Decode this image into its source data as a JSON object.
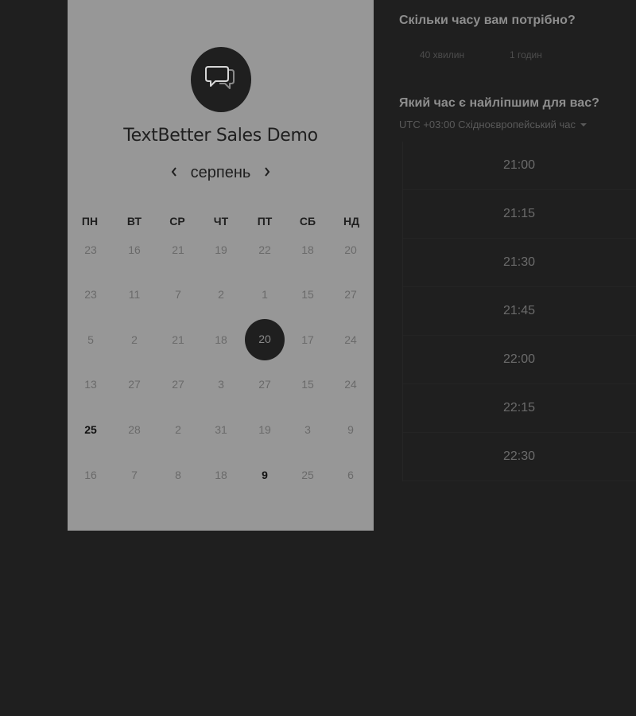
{
  "event": {
    "title": "TextBetter Sales Demo",
    "logo_icon": "chat-bubbles-icon"
  },
  "calendar": {
    "month": "серпень",
    "weekdays": [
      "ПН",
      "ВТ",
      "СР",
      "ЧТ",
      "ПТ",
      "СБ",
      "НД"
    ],
    "weeks": [
      [
        "23",
        "16",
        "21",
        "19",
        "22",
        "18",
        "20"
      ],
      [
        "23",
        "11",
        "7",
        "2",
        "1",
        "15",
        "27"
      ],
      [
        "5",
        "2",
        "21",
        "18",
        "20",
        "17",
        "24"
      ],
      [
        "13",
        "27",
        "27",
        "3",
        "27",
        "15",
        "24"
      ],
      [
        "25",
        "28",
        "2",
        "31",
        "19",
        "3",
        "9"
      ],
      [
        "16",
        "7",
        "8",
        "18",
        "9",
        "25",
        "6"
      ]
    ],
    "selected_day": "20",
    "active_days": [
      "25",
      "9"
    ]
  },
  "duration": {
    "question": "Скільки часу вам потрібно?",
    "options": [
      "40 хвилин",
      "1 годин"
    ]
  },
  "time": {
    "question": "Який час є найліпшим для вас?",
    "timezone": "UTC +03:00 Східноєвропейський час",
    "slots": [
      "21:00",
      "21:15",
      "21:30",
      "21:45",
      "22:00",
      "22:15",
      "22:30"
    ]
  },
  "colors": {
    "background": "#1f1f1f",
    "panel": "#979797"
  }
}
